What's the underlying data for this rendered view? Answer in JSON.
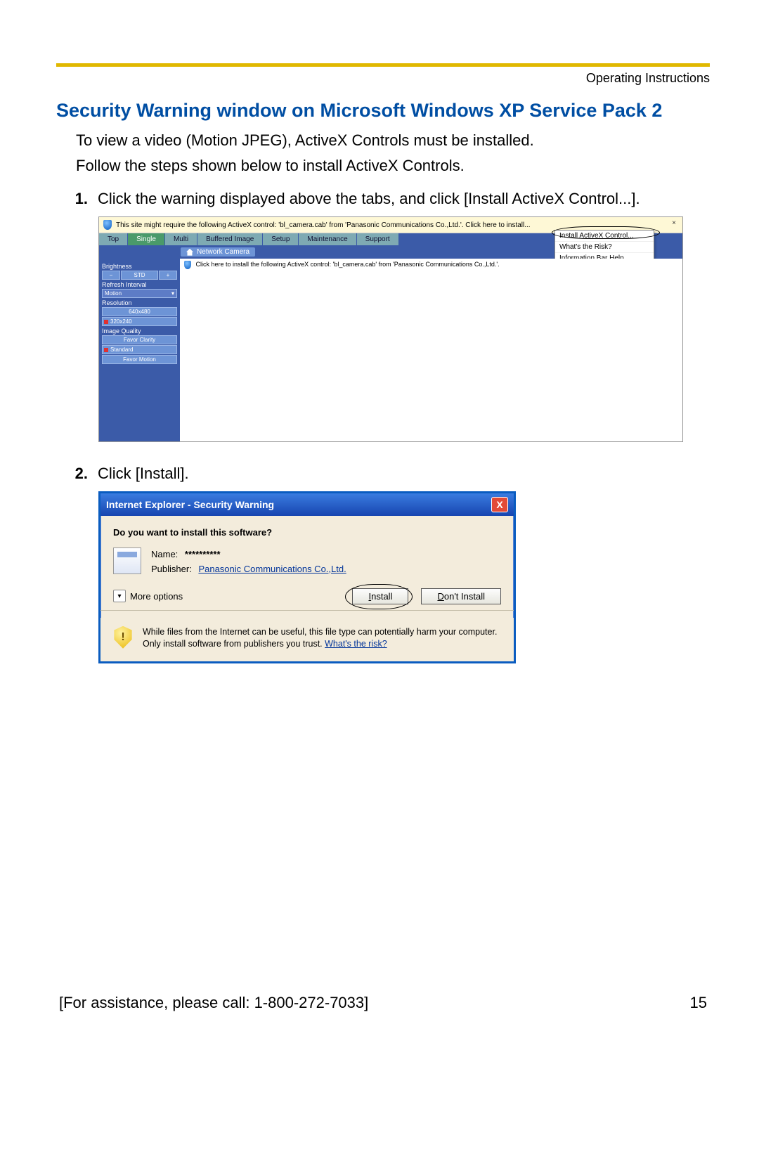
{
  "header_label": "Operating Instructions",
  "title": "Security Warning window on Microsoft Windows XP Service Pack 2",
  "intro_line1": "To view a video (Motion JPEG), ActiveX Controls must be installed.",
  "intro_line2": "Follow the steps shown below to install ActiveX Controls.",
  "steps": {
    "s1_num": "1.",
    "s1_text": "Click the warning displayed above the tabs, and click [Install ActiveX Control...].",
    "s2_num": "2.",
    "s2_text": "Click [Install]."
  },
  "fig1": {
    "infobar_text": "This site might require the following ActiveX control: 'bl_camera.cab' from 'Panasonic Communications Co.,Ltd.'. Click here to install...",
    "infobar_close": "×",
    "ctx": {
      "install": "Install ActiveX Control...",
      "risk": "What's the Risk?",
      "help": "Information Bar Help"
    },
    "tabs": [
      "Top",
      "Single",
      "Multi",
      "Buffered Image",
      "Setup",
      "Maintenance",
      "Support"
    ],
    "subbar": "Network Camera",
    "content_text": "Click here to install the following ActiveX control: 'bl_camera.cab' from 'Panasonic Communications Co.,Ltd.'.",
    "sidebar": {
      "brightness": "Brightness",
      "minus": "−",
      "std": "STD",
      "plus": "+",
      "refresh": "Refresh Interval",
      "motion": "Motion",
      "motion_arrow": "▾",
      "resolution": "Resolution",
      "res640": "640x480",
      "res320": "320x240",
      "quality": "Image Quality",
      "clarity": "Favor Clarity",
      "standard": "Standard",
      "favmotion": "Favor Motion"
    }
  },
  "dlg": {
    "title": "Internet Explorer - Security Warning",
    "close": "X",
    "question": "Do you want to install this software?",
    "name_label": "Name:",
    "name_value": "**********",
    "pub_label": "Publisher:",
    "pub_value": "Panasonic Communications Co.,Ltd.",
    "more_chev": "▾",
    "more": "More options",
    "install_u": "I",
    "install_rest": "nstall",
    "dont_u": "D",
    "dont_rest": "on't Install",
    "warn_text": "While files from the Internet can be useful, this file type can potentially harm your computer. Only install software from publishers you trust. ",
    "warn_link": "What's the risk?"
  },
  "footer": {
    "assist": "[For assistance, please call: 1-800-272-7033]",
    "page": "15"
  }
}
